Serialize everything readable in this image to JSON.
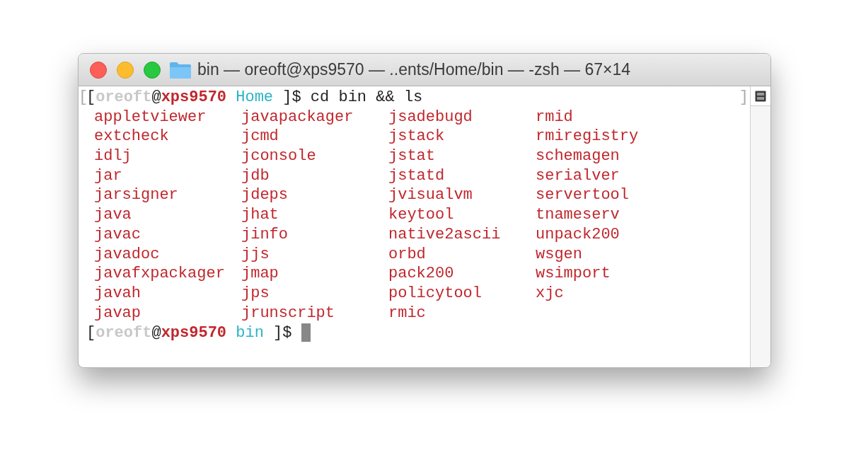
{
  "window": {
    "title": "bin — oreoft@xps9570 — ..ents/Home/bin — -zsh — 67×14"
  },
  "terminal": {
    "lines": [
      {
        "kind": "prompt",
        "mark_left": "[",
        "mark_right": "]",
        "segments": [
          {
            "kind": "plain",
            "text": "["
          },
          {
            "kind": "user",
            "text": "oreoft"
          },
          {
            "kind": "plain",
            "text": "@"
          },
          {
            "kind": "host",
            "text": "xps9570"
          },
          {
            "kind": "dir",
            "text": "Home"
          },
          {
            "kind": "plain",
            "text": " ]$ cd bin && ls"
          }
        ]
      },
      {
        "kind": "listing",
        "rows": [
          [
            "appletviewer",
            "javapackager",
            "jsadebugd",
            "rmid"
          ],
          [
            "extcheck",
            "jcmd",
            "jstack",
            "rmiregistry"
          ],
          [
            "idlj",
            "jconsole",
            "jstat",
            "schemagen"
          ],
          [
            "jar",
            "jdb",
            "jstatd",
            "serialver"
          ],
          [
            "jarsigner",
            "jdeps",
            "jvisualvm",
            "servertool"
          ],
          [
            "java",
            "jhat",
            "keytool",
            "tnameserv"
          ],
          [
            "javac",
            "jinfo",
            "native2ascii",
            "unpack200"
          ],
          [
            "javadoc",
            "jjs",
            "orbd",
            "wsgen"
          ],
          [
            "javafxpackager",
            "jmap",
            "pack200",
            "wsimport"
          ],
          [
            "javah",
            "jps",
            "policytool",
            "xjc"
          ],
          [
            "javap",
            "jrunscript",
            "rmic"
          ]
        ]
      },
      {
        "kind": "prompt",
        "cursor": true,
        "segments": [
          {
            "kind": "plain",
            "text": "["
          },
          {
            "kind": "user",
            "text": "oreoft"
          },
          {
            "kind": "plain",
            "text": "@"
          },
          {
            "kind": "host",
            "text": "xps9570"
          },
          {
            "kind": "dir",
            "text": "bin"
          },
          {
            "kind": "plain",
            "text": " ]$ "
          }
        ]
      }
    ]
  }
}
